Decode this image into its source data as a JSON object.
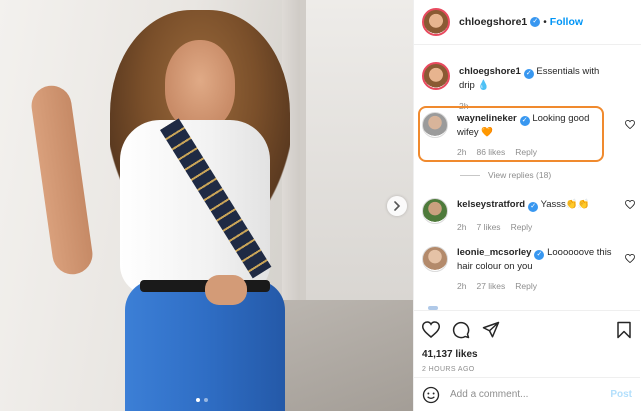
{
  "header": {
    "username": "chloegshore1",
    "separator": "•",
    "follow_label": "Follow",
    "avatar_icon": "profile-avatar"
  },
  "caption": {
    "username": "chloegshore1",
    "text": "Essentials with drip 💧",
    "time": "2h"
  },
  "comments": [
    {
      "username": "waynelineker",
      "verified": true,
      "text": "Looking good wifey 🧡",
      "time": "2h",
      "likes": "86 likes",
      "reply": "Reply",
      "highlighted": true
    },
    {
      "username": "kelseystratford",
      "verified": true,
      "text": "Yasss👏👏",
      "time": "2h",
      "likes": "7 likes",
      "reply": "Reply"
    },
    {
      "username": "leonie_mcsorley",
      "verified": true,
      "text": "Loooooove this hair colour on you",
      "time": "2h",
      "likes": "27 likes",
      "reply": "Reply"
    }
  ],
  "view_replies": "View replies (18)",
  "actions": {
    "likes": "41,137 likes",
    "time_ago": "2 HOURS AGO",
    "icons": [
      "heart-icon",
      "comment-icon",
      "share-icon",
      "bookmark-icon"
    ]
  },
  "add_comment": {
    "placeholder": "Add a comment...",
    "post_label": "Post",
    "icon": "emoji-icon"
  },
  "carousel": {
    "dots": 2,
    "active_index": 0
  },
  "colors": {
    "link_blue": "#0095f6",
    "verified_blue": "#3897f0",
    "highlight_orange": "#f08a2e",
    "post_disabled": "#b2dffc"
  }
}
